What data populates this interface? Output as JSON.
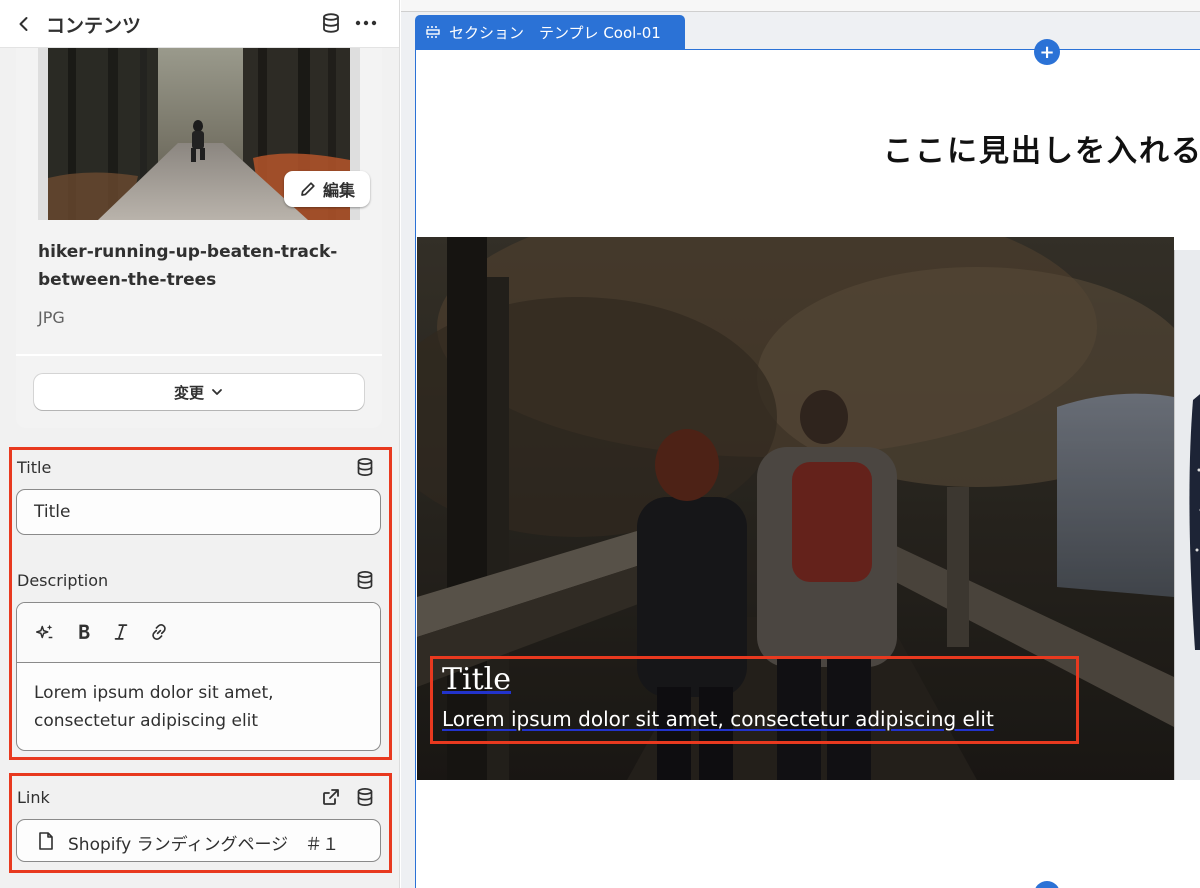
{
  "header": {
    "title": "コンテンツ",
    "back_icon": "chevron-left-icon",
    "source_icon": "database-icon",
    "more_icon": "ellipsis-icon"
  },
  "image_card": {
    "edit_label": "編集",
    "file_name": "hiker-running-up-beaten-track-between-the-trees",
    "file_type": "JPG",
    "change_label": "変更"
  },
  "fields": {
    "title": {
      "label": "Title",
      "value": "Title"
    },
    "description": {
      "label": "Description",
      "toolbar": [
        "magic-icon",
        "bold-icon",
        "italic-icon",
        "link-icon"
      ],
      "value": "Lorem ipsum dolor sit amet, consectetur adipiscing elit"
    },
    "link": {
      "label": "Link",
      "value": "Shopify ランディングページ　＃１"
    }
  },
  "preview": {
    "section_tag": "セクション　テンプレ Cool-01",
    "heading": "ここに見出しを入れる",
    "hero_title": "Title",
    "hero_description": "Lorem ipsum dolor sit amet, consectetur adipiscing elit",
    "add_icon": "plus",
    "highlight_color": "#e8391f",
    "accent_color": "#2b72d6"
  }
}
